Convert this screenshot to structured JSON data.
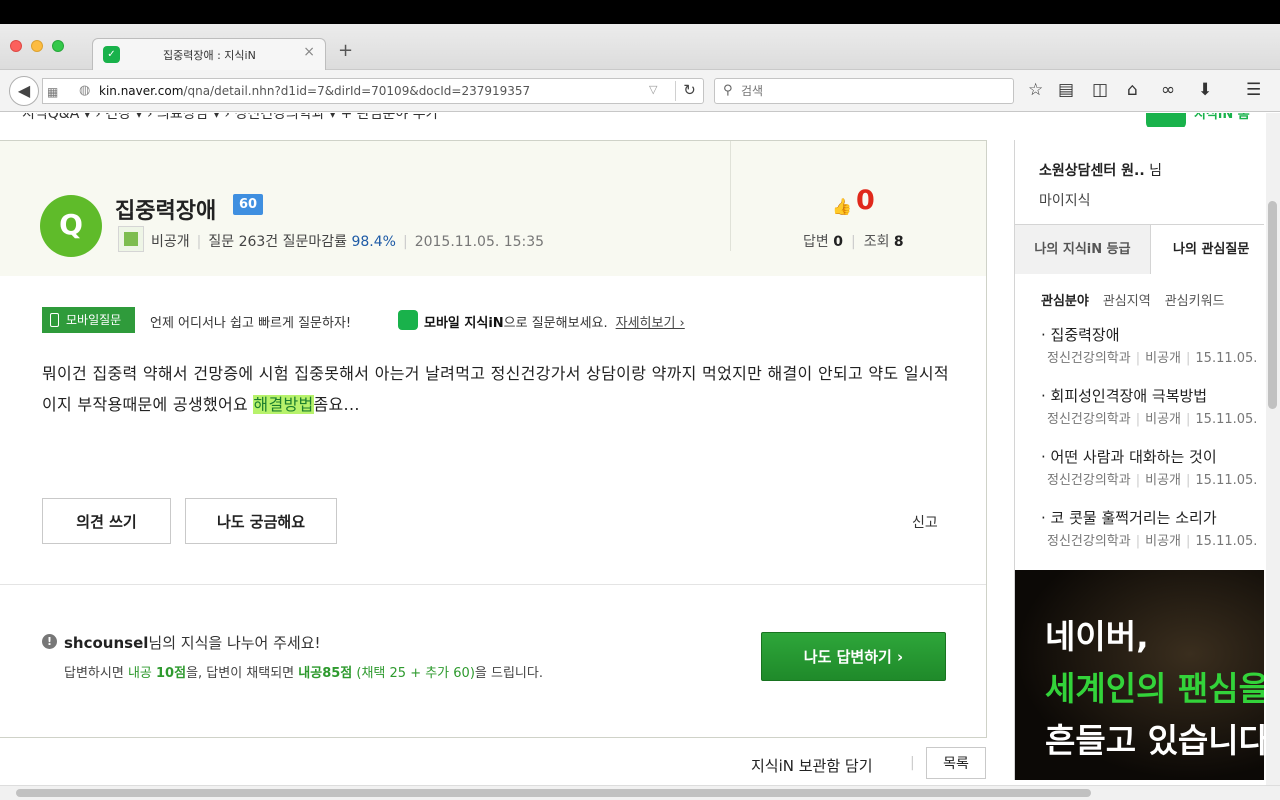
{
  "browser": {
    "tab_title": "집중력장애 : 지식iN",
    "tab_close": "×",
    "new_tab": "+",
    "url_host": "kin.naver.com",
    "url_path": "/qna/detail.nhn?d1id=7&dirId=70109&docId=237919357",
    "search_placeholder": "검색"
  },
  "breadcrumb": {
    "text": "지식Q&A ▾  ›  건강 ▾  ›  의료상담 ▾  ›  정신건강의학과 ▾   + 관심분야 추가",
    "right_text": "지식iN 홈"
  },
  "question": {
    "badge": "Q",
    "title": "집중력장애",
    "level": "60",
    "author": "비공개",
    "question_count": "질문 263건",
    "close_rate_label": "질문마감률",
    "close_rate": "98.4%",
    "date": "2015.11.05. 15:35",
    "like_count": "0",
    "answers_label": "답변",
    "answers": "0",
    "views_label": "조회",
    "views": "8",
    "body_pre": "뭐이건 집중력 약해서 건망증에 시험 집중못해서 아는거 날려먹고 정신건강가서 상담이랑 약까지 먹었지만 해결이 안되고 약도 일시적이지 부작용때문에 공생했어요 ",
    "body_highlight": "해결방법",
    "body_post": "좀요..."
  },
  "mobile": {
    "tag": "모바일질문",
    "text": "언제 어디서나 쉽고 빠르게 질문하자!",
    "app_name": "모바일 지식iN",
    "text2": "으로 질문해보세요.",
    "link": "자세히보기 ›"
  },
  "actions": {
    "opinion": "의견 쓰기",
    "curious": "나도 궁금해요",
    "report": "신고"
  },
  "share": {
    "icon": "!",
    "user": "shcounsel",
    "line1_suffix": "님의 지식을 나누어 주세요!",
    "line2_a": "답변하시면 ",
    "line2_b": "내공 ",
    "line2_c": "10점",
    "line2_d": "을, 답변이 채택되면 ",
    "line2_e": "내공85점",
    "line2_f": " (채택 25 + 추가 60)",
    "line2_g": "을 드립니다.",
    "answer_button": "나도 답변하기 ›"
  },
  "footer": {
    "keep": "지식iN 보관함 담기",
    "list": "목록"
  },
  "sidebar": {
    "user_name": "소원상담센터 원..",
    "user_suffix": " 님",
    "my_knowledge": "마이지식",
    "tab_grade": "나의 지식iN 등급",
    "tab_interest": "나의 관심질문",
    "sub_field": "관심분야",
    "sub_region": "관심지역",
    "sub_keyword": "관심키워드",
    "items": [
      {
        "title": "· 집중력장애",
        "category": "정신건강의학과",
        "author": "비공개",
        "date": "15.11.05."
      },
      {
        "title": "· 회피성인격장애 극복방법",
        "category": "정신건강의학과",
        "author": "비공개",
        "date": "15.11.05."
      },
      {
        "title": "· 어떤 사람과 대화하는 것이",
        "category": "정신건강의학과",
        "author": "비공개",
        "date": "15.11.05."
      },
      {
        "title": "· 코 콧물 훌쩍거리는 소리가",
        "category": "정신건강의학과",
        "author": "비공개",
        "date": "15.11.05."
      }
    ]
  },
  "ad": {
    "line1": "네이버,",
    "line2": "세계인의 팬심을",
    "line3": "흔들고 있습니다"
  },
  "icons": [
    "back-arrow-icon",
    "grid-icon",
    "globe-icon",
    "dropdown-icon",
    "reload-icon",
    "search-icon",
    "star-icon",
    "reading-list-icon",
    "sidebar-icon",
    "home-icon",
    "mask-icon",
    "download-icon",
    "menu-icon",
    "thumbs-up-icon",
    "phone-icon"
  ]
}
